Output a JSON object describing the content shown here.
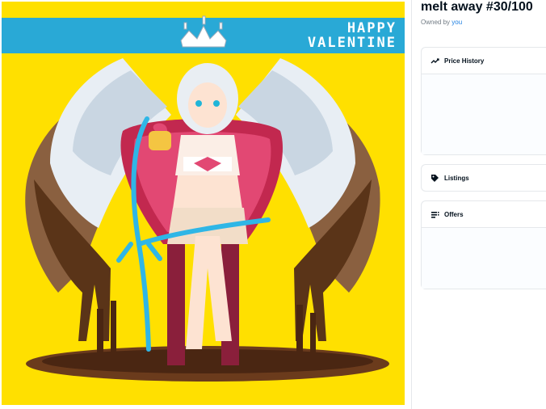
{
  "item": {
    "title": "melt away #30/100",
    "owned_by_prefix": "Owned by",
    "owner_link": "you"
  },
  "artwork": {
    "banner_line1": "HAPPY",
    "banner_line2": "VALENTINE",
    "background_color": "#ffe000",
    "banner_color": "#29a9d6"
  },
  "panels": [
    {
      "label": "Price History",
      "icon": "trending-line-icon"
    },
    {
      "label": "Listings",
      "icon": "tag-icon"
    },
    {
      "label": "Offers",
      "icon": "list-icon"
    }
  ]
}
